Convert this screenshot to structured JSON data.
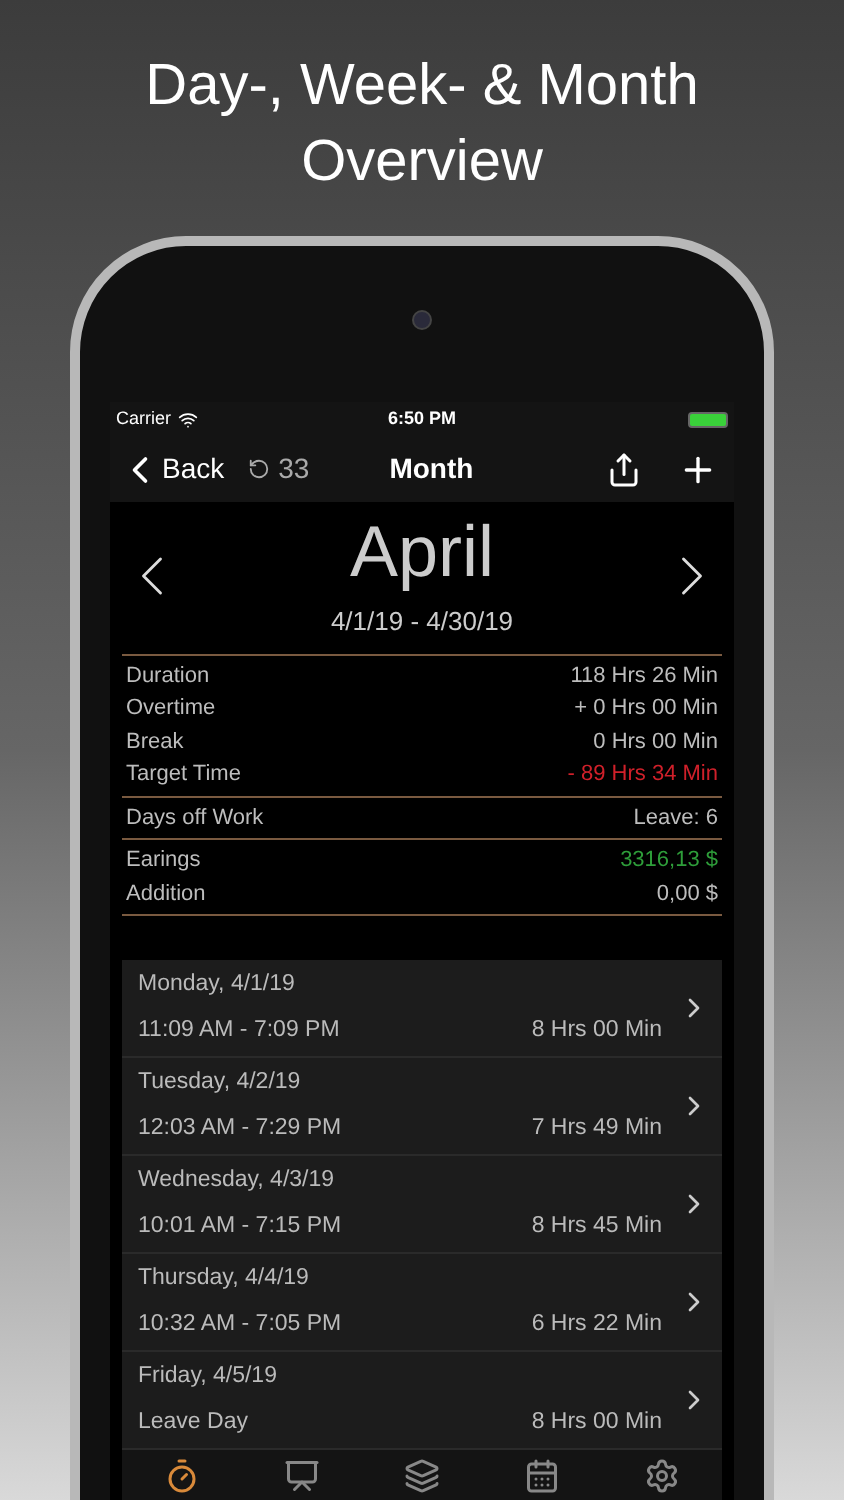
{
  "headline_lines": [
    "Day-, Week- & Month",
    "Overview"
  ],
  "status_bar": {
    "carrier": "Carrier",
    "time": "6:50 PM"
  },
  "nav": {
    "back": "Back",
    "counter": "33",
    "title": "Month"
  },
  "period": {
    "month": "April",
    "range": "4/1/19 - 4/30/19"
  },
  "stat_groups": [
    [
      {
        "label": "Duration",
        "value": "118 Hrs 26 Min",
        "color": "#bdbdbd"
      },
      {
        "label": "Overtime",
        "value": "+ 0 Hrs 00 Min",
        "color": "#bdbdbd"
      },
      {
        "label": "Break",
        "value": "0 Hrs 00 Min",
        "color": "#bdbdbd"
      },
      {
        "label": "Target Time",
        "value": "- 89 Hrs 34 Min",
        "color": "#d0202a"
      }
    ],
    [
      {
        "label": "Days off Work",
        "value": "Leave: 6",
        "color": "#bdbdbd"
      }
    ],
    [
      {
        "label": "Earings",
        "value": "3316,13 $",
        "color": "#2e9e3a"
      },
      {
        "label": "Addition",
        "value": "0,00 $",
        "color": "#bdbdbd"
      }
    ]
  ],
  "days": [
    {
      "date": "Monday, 4/1/19",
      "time": "11:09 AM - 7:09 PM",
      "duration": "8 Hrs 00 Min"
    },
    {
      "date": "Tuesday, 4/2/19",
      "time": "12:03 AM - 7:29 PM",
      "duration": "7 Hrs 49 Min"
    },
    {
      "date": "Wednesday, 4/3/19",
      "time": "10:01 AM - 7:15 PM",
      "duration": "8 Hrs 45 Min"
    },
    {
      "date": "Thursday, 4/4/19",
      "time": "10:32 AM - 7:05 PM",
      "duration": "6 Hrs 22 Min"
    },
    {
      "date": "Friday, 4/5/19",
      "time": "Leave Day",
      "duration": "8 Hrs 00 Min"
    }
  ],
  "tab_bar": [
    {
      "kind": "timer",
      "selected": true
    },
    {
      "kind": "chart",
      "selected": false
    },
    {
      "kind": "layers",
      "selected": false
    },
    {
      "kind": "calendar",
      "selected": false
    },
    {
      "kind": "settings",
      "selected": false
    }
  ]
}
